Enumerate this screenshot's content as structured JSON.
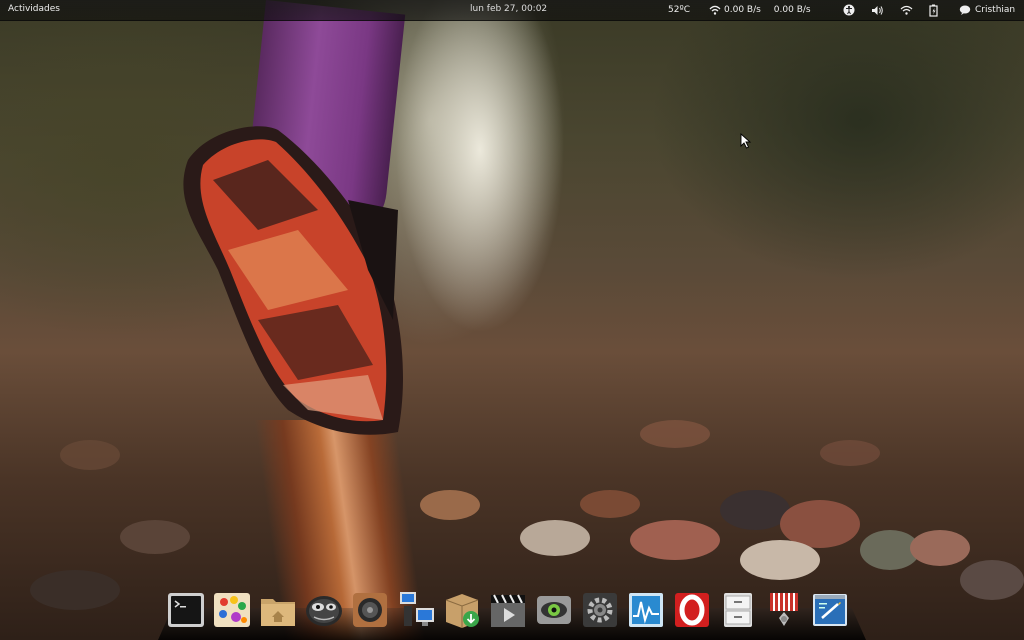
{
  "panel": {
    "activities_label": "Actividades",
    "clock": "lun feb 27, 00:02",
    "temperature": "52ºC",
    "net_down": "0.00 B/s",
    "net_up": "0.00 B/s",
    "user_name": "Cristhian",
    "icons": [
      "network-wireless-icon",
      "accessibility-icon",
      "volume-icon",
      "wifi-icon",
      "battery-icon",
      "user-status-icon"
    ]
  },
  "dock": {
    "items": [
      "terminal-icon",
      "paint-palette-icon",
      "home-folder-icon",
      "eye-of-gnome-icon",
      "speaker-icon",
      "network-computers-icon",
      "package-installer-icon",
      "video-player-icon",
      "system-monitor-eye-icon",
      "system-settings-icon",
      "system-graph-icon",
      "opera-browser-icon",
      "file-cabinet-icon",
      "medal-icon",
      "text-editor-icon"
    ]
  },
  "colors": {
    "panel_bg": "#141414",
    "leg_purple": "#8e4a98",
    "shoe_red": "#c8432a",
    "rail_copper": "#c4703a"
  }
}
